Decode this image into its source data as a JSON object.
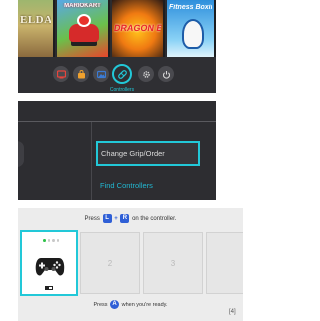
{
  "home": {
    "games": [
      {
        "title": "ELDA"
      },
      {
        "title": "MARIOKART"
      },
      {
        "title": "DRAGON BALL"
      },
      {
        "title": "Fitness Boxing"
      }
    ],
    "buttons": [
      {
        "icon": "news-icon",
        "color": "#e8453c"
      },
      {
        "icon": "shop-icon",
        "color": "#f0a12e"
      },
      {
        "icon": "album-icon",
        "color": "#3a7bd5"
      },
      {
        "icon": "controller-icon",
        "color": "#22c8d8"
      },
      {
        "icon": "gear-icon",
        "color": "#d8d8d8"
      },
      {
        "icon": "power-icon",
        "color": "#d8d8d8"
      }
    ],
    "selected_label": "Controllers"
  },
  "controllers_menu": {
    "options": [
      {
        "label": "Change Grip/Order",
        "selected": true
      },
      {
        "label": "Find Controllers",
        "selected": false
      }
    ]
  },
  "pairing": {
    "top_prefix": "Press",
    "key_left": "L",
    "plus": "+",
    "key_right": "R",
    "top_suffix": "on the controller.",
    "slots": [
      "",
      "2",
      "3",
      ""
    ],
    "bottom_prefix": "Press",
    "button": "A",
    "bottom_suffix": "when you're ready."
  },
  "footnote": "[4]",
  "colors": {
    "accent": "#22c8d8",
    "key_blue": "#2f5fd6",
    "player_led": "#30c24a"
  }
}
